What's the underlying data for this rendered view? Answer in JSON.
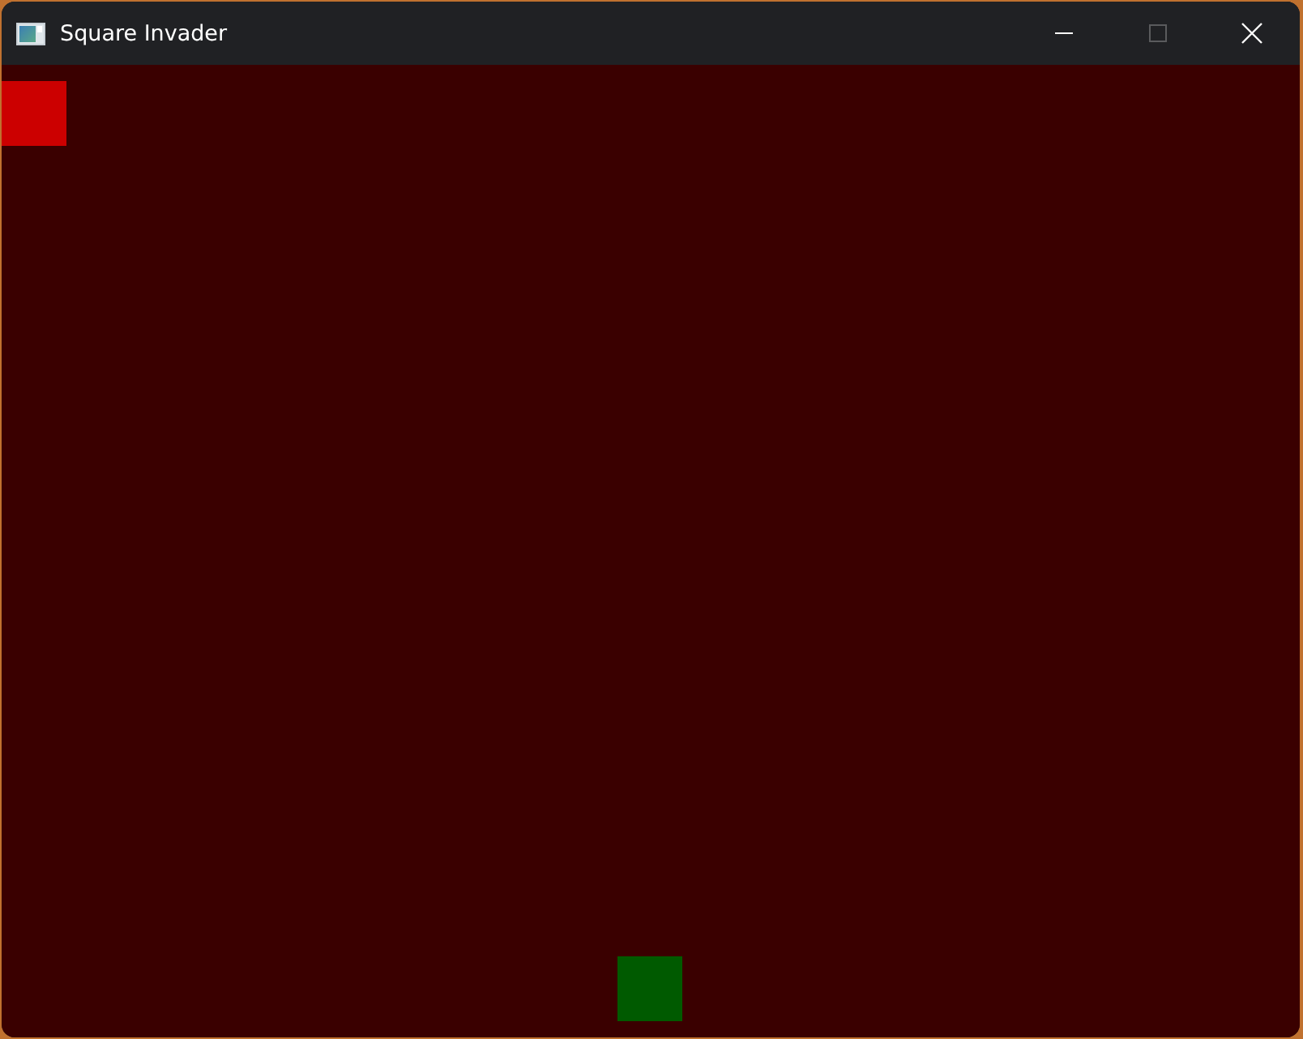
{
  "window": {
    "title": "Square Invader",
    "controls": [
      {
        "kind": "minimize",
        "disabled": false
      },
      {
        "kind": "maximize",
        "disabled": true
      },
      {
        "kind": "close",
        "disabled": false
      }
    ]
  },
  "game": {
    "squares": [
      {
        "kind": "enemy",
        "color": "#cc0000"
      },
      {
        "kind": "player",
        "color": "#005a00"
      }
    ]
  }
}
